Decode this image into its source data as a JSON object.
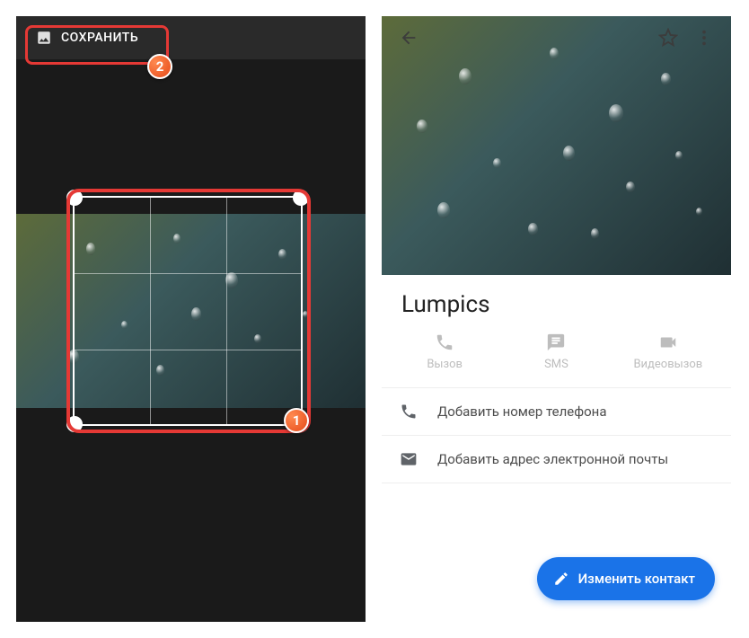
{
  "left": {
    "save_label": "СОХРАНИТЬ",
    "badge_crop": "1",
    "badge_save": "2"
  },
  "right": {
    "contact_name": "Lumpics",
    "actions": {
      "call": "Вызов",
      "sms": "SMS",
      "video": "Видеовызов"
    },
    "add_phone": "Добавить номер телефона",
    "add_email": "Добавить адрес электронной почты",
    "edit_fab": "Изменить контакт"
  }
}
